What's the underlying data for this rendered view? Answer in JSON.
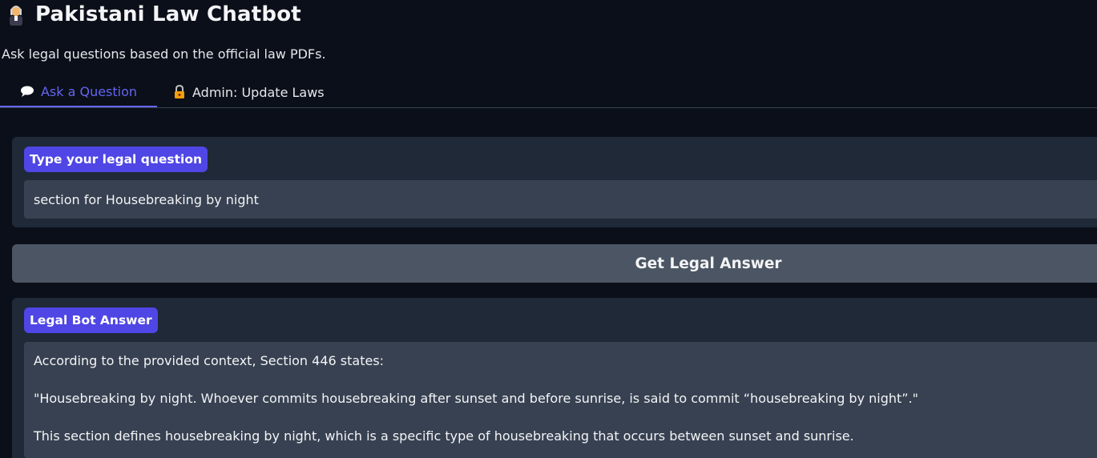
{
  "header": {
    "title": "Pakistani Law Chatbot",
    "title_icon": "judge-emoji-icon",
    "subtitle": "Ask legal questions based on the official law PDFs."
  },
  "tabs": [
    {
      "label": "Ask a Question",
      "icon": "speech-bubble-icon",
      "active": true
    },
    {
      "label": "Admin: Update Laws",
      "icon": "lock-icon",
      "active": false
    }
  ],
  "question": {
    "label": "Type your legal question",
    "value": "section for Housebreaking by night"
  },
  "submit_button": {
    "label": "Get Legal Answer"
  },
  "answer": {
    "label": "Legal Bot Answer",
    "paragraphs": [
      "According to the provided context, Section 446 states:",
      "\"Housebreaking by night. Whoever commits housebreaking after sunset and before sunrise, is said to commit “housebreaking by night”.\"",
      "This section defines housebreaking by night, which is a specific type of housebreaking that occurs between sunset and sunrise."
    ]
  },
  "colors": {
    "background": "#0b0f19",
    "panel": "#1f2937",
    "input": "#374151",
    "accent": "#4f46e5",
    "active_tab": "#6366f1",
    "button": "#4b5563"
  }
}
